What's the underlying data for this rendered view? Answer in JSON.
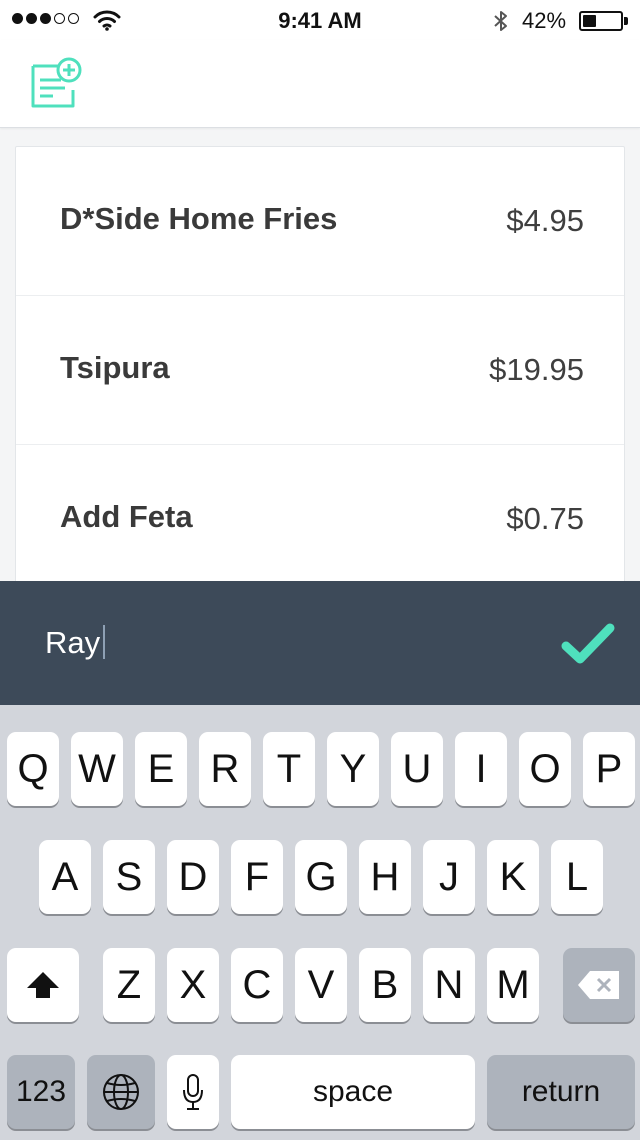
{
  "status_bar": {
    "time": "9:41 AM",
    "battery": "42%",
    "battery_level": 0.42,
    "signal_bars_filled": 3,
    "signal_bars_total": 5
  },
  "header": {
    "new_bill_icon": "receipt-add-icon"
  },
  "items": [
    {
      "name": "D*Side Home Fries",
      "price": "$4.95"
    },
    {
      "name": "Tsipura",
      "price": "$19.95"
    },
    {
      "name": "Add Feta",
      "price": "$0.75"
    }
  ],
  "input": {
    "value": "Ray",
    "confirm_icon": "checkmark-icon",
    "accent": "#4fe0bd"
  },
  "keyboard": {
    "row1": [
      "Q",
      "W",
      "E",
      "R",
      "T",
      "Y",
      "U",
      "I",
      "O",
      "P"
    ],
    "row2": [
      "A",
      "S",
      "D",
      "F",
      "G",
      "H",
      "J",
      "K",
      "L"
    ],
    "row3": [
      "Z",
      "X",
      "C",
      "V",
      "B",
      "N",
      "M"
    ],
    "shift_icon": "shift-icon",
    "delete_icon": "backspace-icon",
    "numbers_label": "123",
    "globe_icon": "globe-icon",
    "mic_icon": "microphone-icon",
    "space_label": "space",
    "return_label": "return"
  },
  "colors": {
    "accent": "#4fe0bd",
    "input_bar": "#3d4a59",
    "keyboard_bg": "#d2d5db"
  }
}
